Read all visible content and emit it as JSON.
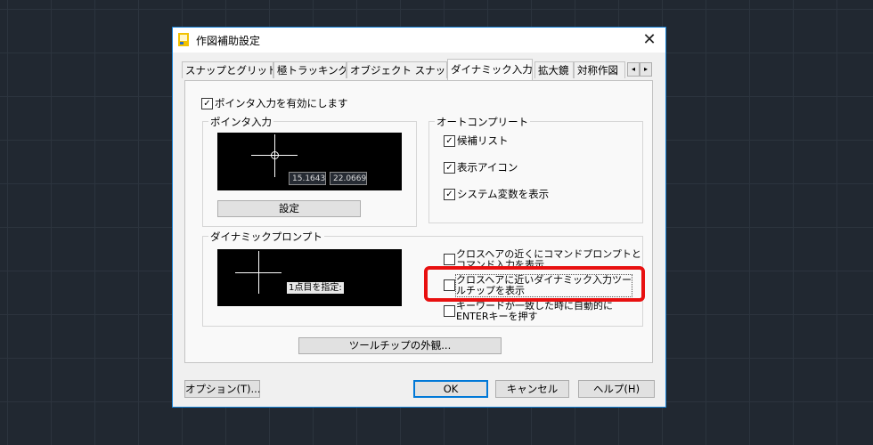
{
  "dialog": {
    "title": "作図補助設定",
    "close_glyph": "✕"
  },
  "tabs": [
    {
      "label": "スナップとグリッド"
    },
    {
      "label": "極トラッキング"
    },
    {
      "label": "オブジェクト スナップ"
    },
    {
      "label": "ダイナミック入力",
      "active": true
    },
    {
      "label": "拡大鏡"
    },
    {
      "label": "対称作図"
    }
  ],
  "tab_scroll": {
    "left": "◂",
    "right": "▸"
  },
  "pointer_input": {
    "enable_label": "ポインタ入力を有効にします",
    "enable_checked": true,
    "group_label": "ポインタ入力",
    "coord_x": "15.1643",
    "coord_y": "22.0669",
    "settings_button": "設定"
  },
  "autocomplete": {
    "group_label": "オートコンプリート",
    "items": [
      {
        "label": "候補リスト",
        "checked": true
      },
      {
        "label": "表示アイコン",
        "checked": true
      },
      {
        "label": "システム変数を表示",
        "checked": true
      }
    ]
  },
  "dynamic_prompt": {
    "group_label": "ダイナミックプロンプト",
    "prompt_text": "1点目を指定:",
    "options": [
      {
        "line1": "クロスヘアの近くにコマンドプロンプトと",
        "line2": "コマンド入力を表示",
        "checked": false
      },
      {
        "line1": "クロスヘアに近いダイナミック入力ツー",
        "line2": "ルチップを表示",
        "checked": false
      },
      {
        "line1": "キーワードが一致した時に自動的に",
        "line2": "ENTERキーを押す",
        "checked": false
      }
    ]
  },
  "tooltip_button": "ツールチップの外観...",
  "footer": {
    "options_button": "オプション(T)...",
    "ok_button": "OK",
    "cancel_button": "キャンセル",
    "help_button": "ヘルプ(H)"
  },
  "colors": {
    "highlight": "#e81010",
    "title_border": "#1883d7",
    "preview_bg": "#000000"
  }
}
